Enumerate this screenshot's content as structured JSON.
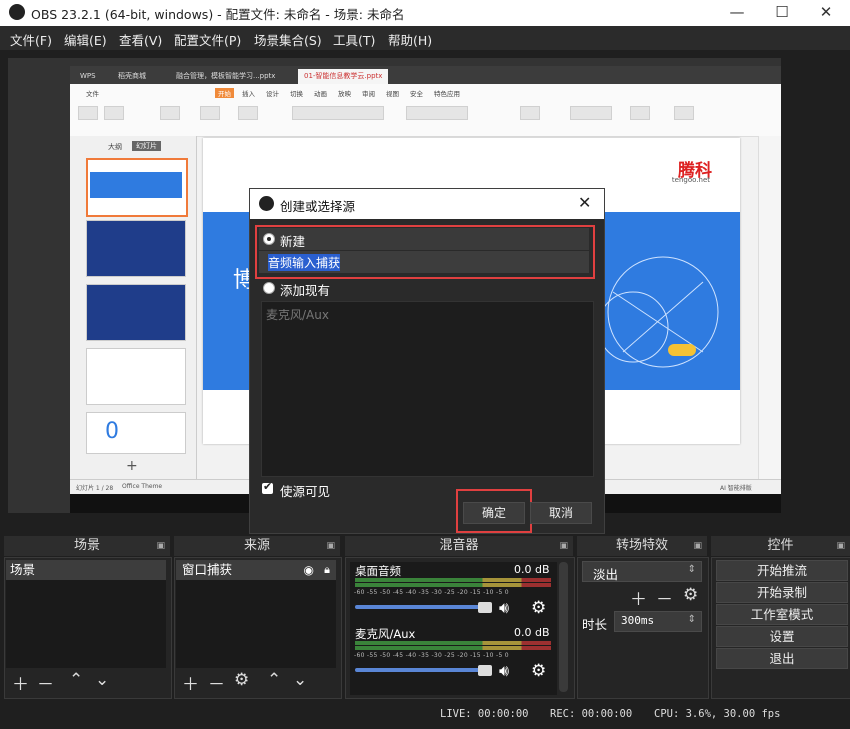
{
  "window": {
    "title": "OBS 23.2.1 (64-bit, windows) - 配置文件: 未命名 - 场景: 未命名",
    "minimize": "—",
    "maximize": "☐",
    "close": "✕"
  },
  "menu": [
    "文件(F)",
    "编辑(E)",
    "查看(V)",
    "配置文件(P)",
    "场景集合(S)",
    "工具(T)",
    "帮助(H)"
  ],
  "preview": {
    "tabs": [
      "WPS",
      "稻壳商城",
      "融合管理，模板智能学习...pptx",
      "01-智能信息教学云.pptx"
    ],
    "wps_menu": [
      "文件",
      "开始",
      "插入",
      "设计",
      "切换",
      "动画",
      "放映",
      "审阅",
      "视图",
      "安全",
      "特色应用"
    ],
    "thumb_tabs": [
      "大纲",
      "幻灯片"
    ],
    "brand": "腾科",
    "brand_sub": "tengoo.net",
    "slide_big_char": "博",
    "status_left": "幻灯片 1 / 28",
    "status_theme": "Office Theme",
    "status_right": "AI 智能排版"
  },
  "dialog": {
    "title": "创建或选择源",
    "close": "✕",
    "new_label": "新建",
    "new_name_value": "音频输入捕获",
    "existing_label": "添加现有",
    "existing_items": [
      "麦克风/Aux"
    ],
    "visible_label": "使源可见",
    "visible_checked": true,
    "ok": "确定",
    "cancel": "取消"
  },
  "docks": {
    "scenes": {
      "title": "场景",
      "items": [
        "场景"
      ]
    },
    "sources": {
      "title": "来源",
      "items": [
        "窗口捕获"
      ]
    },
    "mixer": {
      "title": "混音器",
      "channels": [
        {
          "name": "桌面音频",
          "level": "0.0 dB"
        },
        {
          "name": "麦克风/Aux",
          "level": "0.0 dB"
        }
      ],
      "ticks": "-60 -55 -50 -45 -40 -35 -30 -25 -20 -15 -10 -5 0"
    },
    "transitions": {
      "title": "转场特效",
      "selected": "淡出",
      "duration_label": "时长",
      "duration_value": "300ms"
    },
    "controls": {
      "title": "控件",
      "buttons": [
        "开始推流",
        "开始录制",
        "工作室模式",
        "设置",
        "退出"
      ]
    }
  },
  "status": {
    "live": "LIVE: 00:00:00",
    "rec": "REC: 00:00:00",
    "cpu": "CPU: 3.6%, 30.00 fps"
  }
}
